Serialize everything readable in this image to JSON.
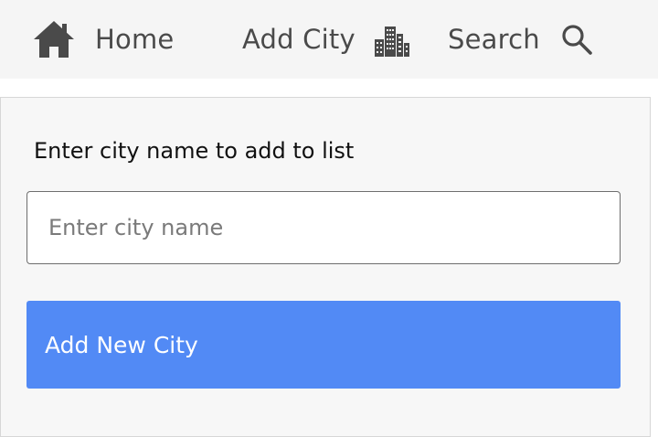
{
  "nav": {
    "home": {
      "label": "Home",
      "icon": "home-icon"
    },
    "add_city": {
      "label": "Add City",
      "icon": "city-buildings-icon"
    },
    "search": {
      "label": "Search",
      "icon": "search-icon"
    }
  },
  "form": {
    "prompt": "Enter city name to add to list",
    "input": {
      "placeholder": "Enter city name",
      "value": ""
    },
    "submit_label": "Add New City"
  },
  "colors": {
    "accent": "#528af5",
    "nav_bg": "#f5f5f5",
    "panel_bg": "#f7f7f7",
    "nav_text": "#4a4a4a"
  }
}
